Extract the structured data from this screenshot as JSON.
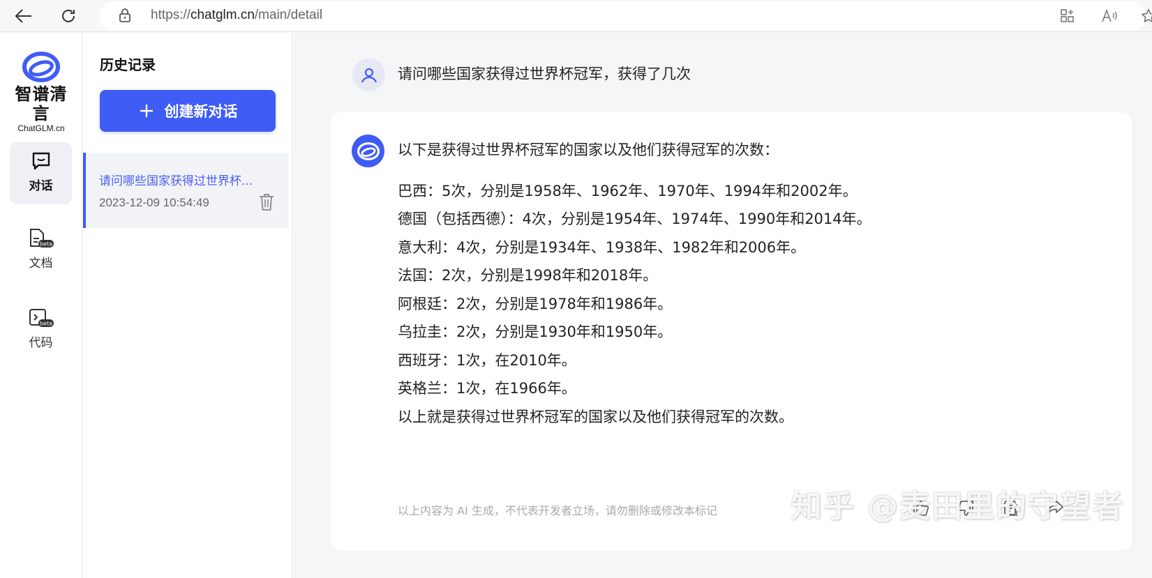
{
  "browser": {
    "url_scheme": "https://",
    "url_host": "chatglm.cn",
    "url_path": "/main/detail"
  },
  "rail": {
    "logo_name": "智谱清言",
    "logo_sub": "ChatGLM.cn",
    "items": [
      {
        "label": "对话",
        "icon": "chat-icon",
        "active": true
      },
      {
        "label": "文档",
        "icon": "document-beta-icon",
        "badge": "beta"
      },
      {
        "label": "代码",
        "icon": "code-beta-icon",
        "badge": "beta"
      }
    ]
  },
  "history": {
    "title": "历史记录",
    "new_chat_label": "创建新对话",
    "items": [
      {
        "question": "请问哪些国家获得过世界杯...",
        "time": "2023-12-09 10:54:49"
      }
    ]
  },
  "conversation": {
    "user_question": "请问哪些国家获得过世界杯冠军，获得了几次",
    "answer_intro": "以下是获得过世界杯冠军的国家以及他们获得冠军的次数：",
    "answer_lines": [
      "巴西：5次，分别是1958年、1962年、1970年、1994年和2002年。",
      "德国（包括西德）：4次，分别是1954年、1974年、1990年和2014年。",
      "意大利：4次，分别是1934年、1938年、1982年和2006年。",
      "法国：2次，分别是1998年和2018年。",
      "阿根廷：2次，分别是1978年和1986年。",
      "乌拉圭：2次，分别是1930年和1950年。",
      "西班牙：1次，在2010年。",
      "英格兰：1次，在1966年。",
      "以上就是获得过世界杯冠军的国家以及他们获得冠军的次数。"
    ],
    "disclaimer": "以上内容为 AI 生成，不代表开发者立场，请勿删除或修改本标记",
    "actions": [
      "thumbs-up-icon",
      "thumbs-down-icon",
      "copy-icon",
      "share-icon"
    ]
  },
  "watermark": "知乎 @麦田里的守望者",
  "colors": {
    "accent": "#3f5cf5",
    "page_bg": "#f5f6f8"
  }
}
